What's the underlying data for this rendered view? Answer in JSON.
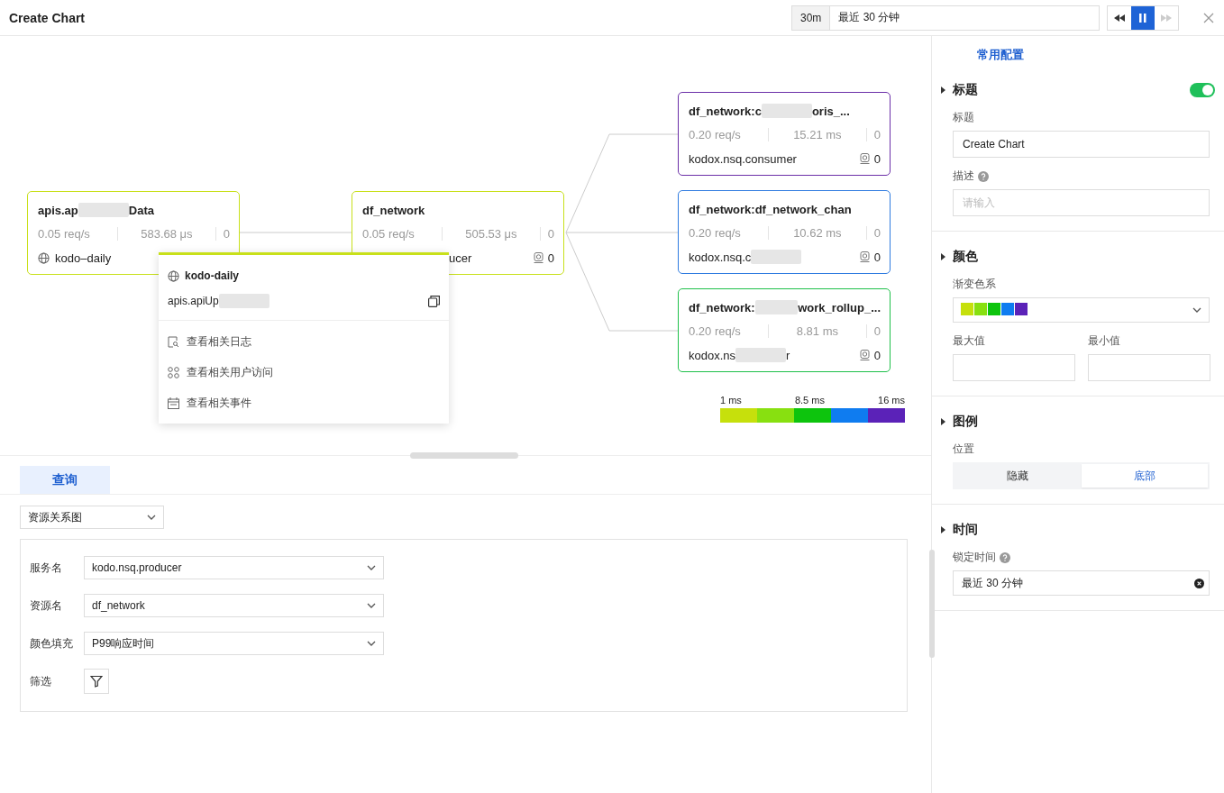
{
  "window": {
    "title": "Create Chart"
  },
  "time_bar": {
    "badge": "30m",
    "value": "最近 30 分钟",
    "buttons": [
      {
        "kind": "rewind",
        "active": false,
        "disabled": false
      },
      {
        "kind": "pause",
        "active": true,
        "disabled": false
      },
      {
        "kind": "forward",
        "active": false,
        "disabled": true
      }
    ]
  },
  "graph": {
    "nodes": [
      {
        "title": [
          {
            "text": "apis.ap"
          },
          {
            "kind": "redacted"
          },
          {
            "text": "Data"
          }
        ],
        "color": "#c8e01a",
        "metrics": [
          "0.05 req/s",
          "583.68 μs",
          "0"
        ],
        "globe_icon": true,
        "service": [
          {
            "text": "kodo–daily"
          }
        ]
      },
      {
        "title": [
          {
            "text": "df_network"
          }
        ],
        "color": "#c8e01a",
        "metrics": [
          "0.05 req/s",
          "505.53 μs",
          "0"
        ],
        "service": [
          {
            "text": "ucer"
          }
        ],
        "count": "0"
      },
      {
        "title": [
          {
            "text": "df_network:c"
          },
          {
            "kind": "redacted"
          },
          {
            "text": "oris_..."
          }
        ],
        "color": "#6b2fa8",
        "metrics": [
          "0.20 req/s",
          "15.21 ms",
          "0"
        ],
        "service": [
          {
            "text": "kodox.nsq.consumer"
          }
        ],
        "count": "0"
      },
      {
        "title": [
          {
            "text": "df_network:df_network_chan"
          }
        ],
        "color": "#2f7be0",
        "metrics": [
          "0.20 req/s",
          "10.62 ms",
          "0"
        ],
        "service": [
          {
            "text": "kodox.nsq.c"
          },
          {
            "kind": "redacted"
          }
        ],
        "count": "0"
      },
      {
        "title": [
          {
            "text": "df_network:"
          },
          {
            "kind": "redacted"
          },
          {
            "text": "work_rollup_..."
          }
        ],
        "color": "#1fc04a",
        "metrics": [
          "0.20 req/s",
          "8.81 ms",
          "0"
        ],
        "service": [
          {
            "text": "kodox.ns"
          },
          {
            "kind": "redacted"
          },
          {
            "text": "r"
          }
        ],
        "count": "0"
      }
    ],
    "legend": {
      "labels": [
        "1 ms",
        "8.5 ms",
        "16 ms"
      ],
      "colors": [
        {
          "color": "#c6e00c"
        },
        {
          "color": "#88e010"
        },
        {
          "color": "#0dc40d"
        },
        {
          "color": "#0f7cf0"
        },
        {
          "color": "#5b22b8"
        }
      ]
    },
    "popup": {
      "service": "kodo-daily",
      "resource": [
        {
          "text": "apis.apiUp"
        },
        {
          "kind": "redacted"
        }
      ],
      "items": [
        {
          "kind": "log",
          "label": "查看相关日志"
        },
        {
          "kind": "users",
          "label": "查看相关用户访问"
        },
        {
          "kind": "events",
          "label": "查看相关事件"
        }
      ]
    }
  },
  "query": {
    "tabs": [
      {
        "label": "查询",
        "selected": true
      }
    ],
    "chart_type": "资源关系图",
    "fields": [
      {
        "kind": "select",
        "label": "服务名",
        "value": "kodo.nsq.producer"
      },
      {
        "kind": "select",
        "label": "资源名",
        "value": "df_network"
      },
      {
        "kind": "select",
        "label": "颜色填充",
        "value": "P99响应时间"
      },
      {
        "kind": "filter",
        "label": "筛选"
      }
    ]
  },
  "settings": {
    "tab": "常用配置",
    "sections": [
      {
        "title": "标题",
        "toggle": true,
        "fields": [
          {
            "kind": "input",
            "label": "标题",
            "value": "Create Chart"
          },
          {
            "kind": "input",
            "label": "描述",
            "help": true,
            "placeholder": "请输入"
          }
        ]
      },
      {
        "title": "颜色",
        "fields": [
          {
            "kind": "gradient",
            "label": "渐变色系",
            "colors": [
              {
                "color": "#c6e00c"
              },
              {
                "color": "#88e010"
              },
              {
                "color": "#0dc40d"
              },
              {
                "color": "#0f7cf0"
              },
              {
                "color": "#5b22b8"
              }
            ]
          },
          {
            "kind": "pair",
            "items": [
              {
                "label": "最大值"
              },
              {
                "label": "最小值"
              }
            ]
          }
        ]
      },
      {
        "title": "图例",
        "fields": [
          {
            "kind": "segmented",
            "label": "位置",
            "options": [
              {
                "label": "隐藏",
                "selected": false
              },
              {
                "label": "底部",
                "selected": true
              }
            ]
          }
        ]
      },
      {
        "title": "时间",
        "fields": [
          {
            "kind": "clearable",
            "label": "锁定时间",
            "help": true,
            "value": "最近 30 分钟"
          }
        ]
      }
    ]
  }
}
